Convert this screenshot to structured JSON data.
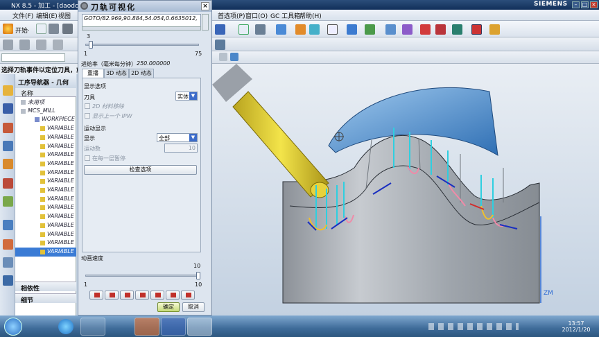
{
  "window": {
    "title": "NX 8.5 - 加工 - [daodong...]",
    "brand": "SIEMENS"
  },
  "menu": {
    "left": [
      "文件(F)",
      "编辑(E)",
      "视图"
    ],
    "right": [
      "首选项(P)",
      "窗口(O)",
      "GC 工具箱",
      "帮助(H)"
    ]
  },
  "toolbar": {
    "start_label": "开始·"
  },
  "status_line": "选择刀轨事件以定位刀具，或",
  "navigator": {
    "title": "工序导航器 - 几何",
    "column_name": "名称",
    "items": [
      {
        "label": "未用项",
        "level": 1
      },
      {
        "label": "MCS_MILL",
        "level": 1
      },
      {
        "label": "WORKPIECE",
        "level": 2
      },
      {
        "label": "VARIABLE",
        "level": 3
      },
      {
        "label": "VARIABLE",
        "level": 3
      },
      {
        "label": "VARIABLE",
        "level": 3
      },
      {
        "label": "VARIABLE",
        "level": 3
      },
      {
        "label": "VARIABLE",
        "level": 3
      },
      {
        "label": "VARIABLE",
        "level": 3
      },
      {
        "label": "VARIABLE",
        "level": 3
      },
      {
        "label": "VARIABLE",
        "level": 3
      },
      {
        "label": "VARIABLE",
        "level": 3
      },
      {
        "label": "VARIABLE",
        "level": 3
      },
      {
        "label": "VARIABLE",
        "level": 3
      },
      {
        "label": "VARIABLE",
        "level": 3
      },
      {
        "label": "VARIABLE",
        "level": 3
      },
      {
        "label": "VARIABLE",
        "level": 3
      },
      {
        "label": "VARIABLE",
        "level": 3,
        "selected": true
      }
    ],
    "sections": [
      "相依性",
      "细节"
    ]
  },
  "dialog": {
    "title": "刀轨可视化",
    "goto_text": "GOTO/82.969,90.884,54.054,0.6635012,",
    "slider": {
      "current": "3",
      "min": "1",
      "max": "75",
      "fraction": 0.03
    },
    "feed_label": "进给率（毫米每分钟）",
    "feed_value": "250.000000",
    "tabs": [
      "重播",
      "3D 动态",
      "2D 动态"
    ],
    "display_options_title": "显示选项",
    "tool_label": "刀具",
    "tool_value": "实体",
    "opt_2d_removal": "2D 材料移除",
    "opt_show_prev_ipw": "显示上一个 IPW",
    "motion_display_title": "运动显示",
    "display_label": "显示",
    "display_value": "全部",
    "motion_count_label": "运动数",
    "motion_count_value": "10",
    "pause_each_layer": "在每一层暂停",
    "check_options_button": "检查选项",
    "anim_speed_label": "动画速度",
    "anim_speed": {
      "current": "10",
      "min": "1",
      "max": "10",
      "fraction": 1.0
    },
    "ok_button": "确定",
    "cancel_button": "取消"
  },
  "viewport": {
    "axis_label": "ZM"
  },
  "clock": {
    "time": "13:57",
    "date": "2012/1/20"
  }
}
